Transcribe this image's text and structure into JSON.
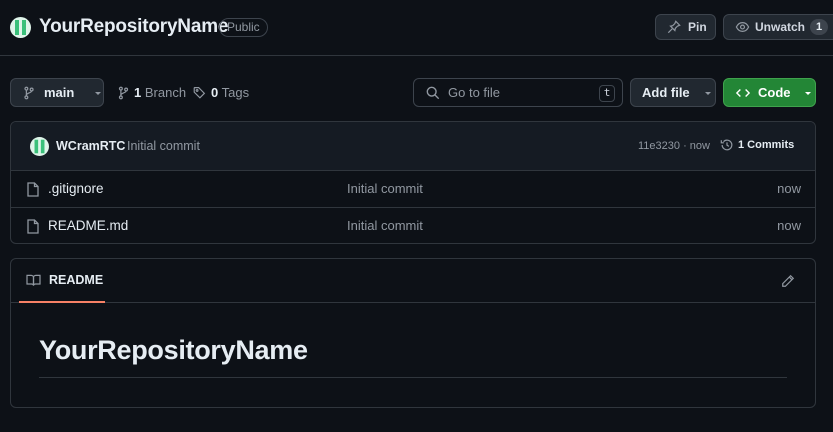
{
  "repo": {
    "name": "YourRepositoryName",
    "visibility": "Public",
    "pin_label": "Pin",
    "watch_label": "Unwatch",
    "watch_count": "1"
  },
  "toolbar": {
    "branch": "main",
    "branches_count": "1",
    "branches_label": "Branch",
    "tags_count": "0",
    "tags_label": "Tags",
    "search_placeholder": "Go to file",
    "search_shortcut": "t",
    "add_file_label": "Add file",
    "code_label": "Code"
  },
  "latest_commit": {
    "author": "WCramRTC",
    "message": "Initial commit",
    "hash_time": "11e3230 · now",
    "commits_label": "1 Commits"
  },
  "files": [
    {
      "name": ".gitignore",
      "message": "Initial commit",
      "time": "now"
    },
    {
      "name": "README.md",
      "message": "Initial commit",
      "time": "now"
    }
  ],
  "readme": {
    "tab_label": "README",
    "heading": "YourRepositoryName"
  },
  "icons": {
    "avatar": "identicon-avatar",
    "pin": "pin-icon",
    "watch": "eye-icon",
    "branch": "git-branch-icon",
    "tag": "tag-icon",
    "search": "search-icon",
    "code": "code-icon",
    "history": "history-icon",
    "file": "file-icon",
    "book": "book-icon",
    "edit": "pencil-icon"
  },
  "colors": {
    "background": "#0d1117",
    "border": "#30363d",
    "code_button": "#238636",
    "tab_underline": "#f78166",
    "avatar": "#dff5ea"
  }
}
